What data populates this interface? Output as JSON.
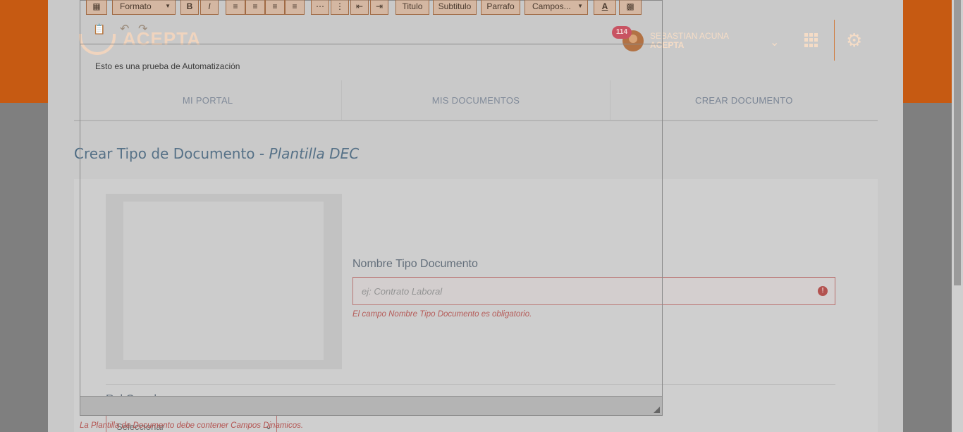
{
  "header": {
    "logo_text": "ACEPTA",
    "notification_count": "114",
    "user_name": "SEBASTIAN ACUNA",
    "user_company": "ACEPTA"
  },
  "nav": {
    "items": [
      {
        "label": "MI PORTAL"
      },
      {
        "label": "MIS DOCUMENTOS"
      },
      {
        "label": "CREAR DOCUMENTO"
      }
    ]
  },
  "page": {
    "title": "Crear Tipo de Documento - ",
    "title_emphasis": "Plantilla DEC"
  },
  "form": {
    "name_label": "Nombre Tipo Documento",
    "name_placeholder": "ej: Contrato Laboral",
    "name_error": "El campo Nombre Tipo Documento es obligatorio.",
    "rol_label": "Rol Creador",
    "rol_value": "Seleccionar"
  },
  "editor": {
    "toolbar": {
      "format_label": "Formato",
      "bold_label": "B",
      "italic_label": "I",
      "titulo_label": "Titulo",
      "subtitulo_label": "Subtitulo",
      "parrafo_label": "Parrafo",
      "campos_label": "Campos..."
    },
    "content": "Esto es una prueba de Automatización",
    "error": "La Plantilla de Documento debe contener Campos Dinamicos."
  }
}
